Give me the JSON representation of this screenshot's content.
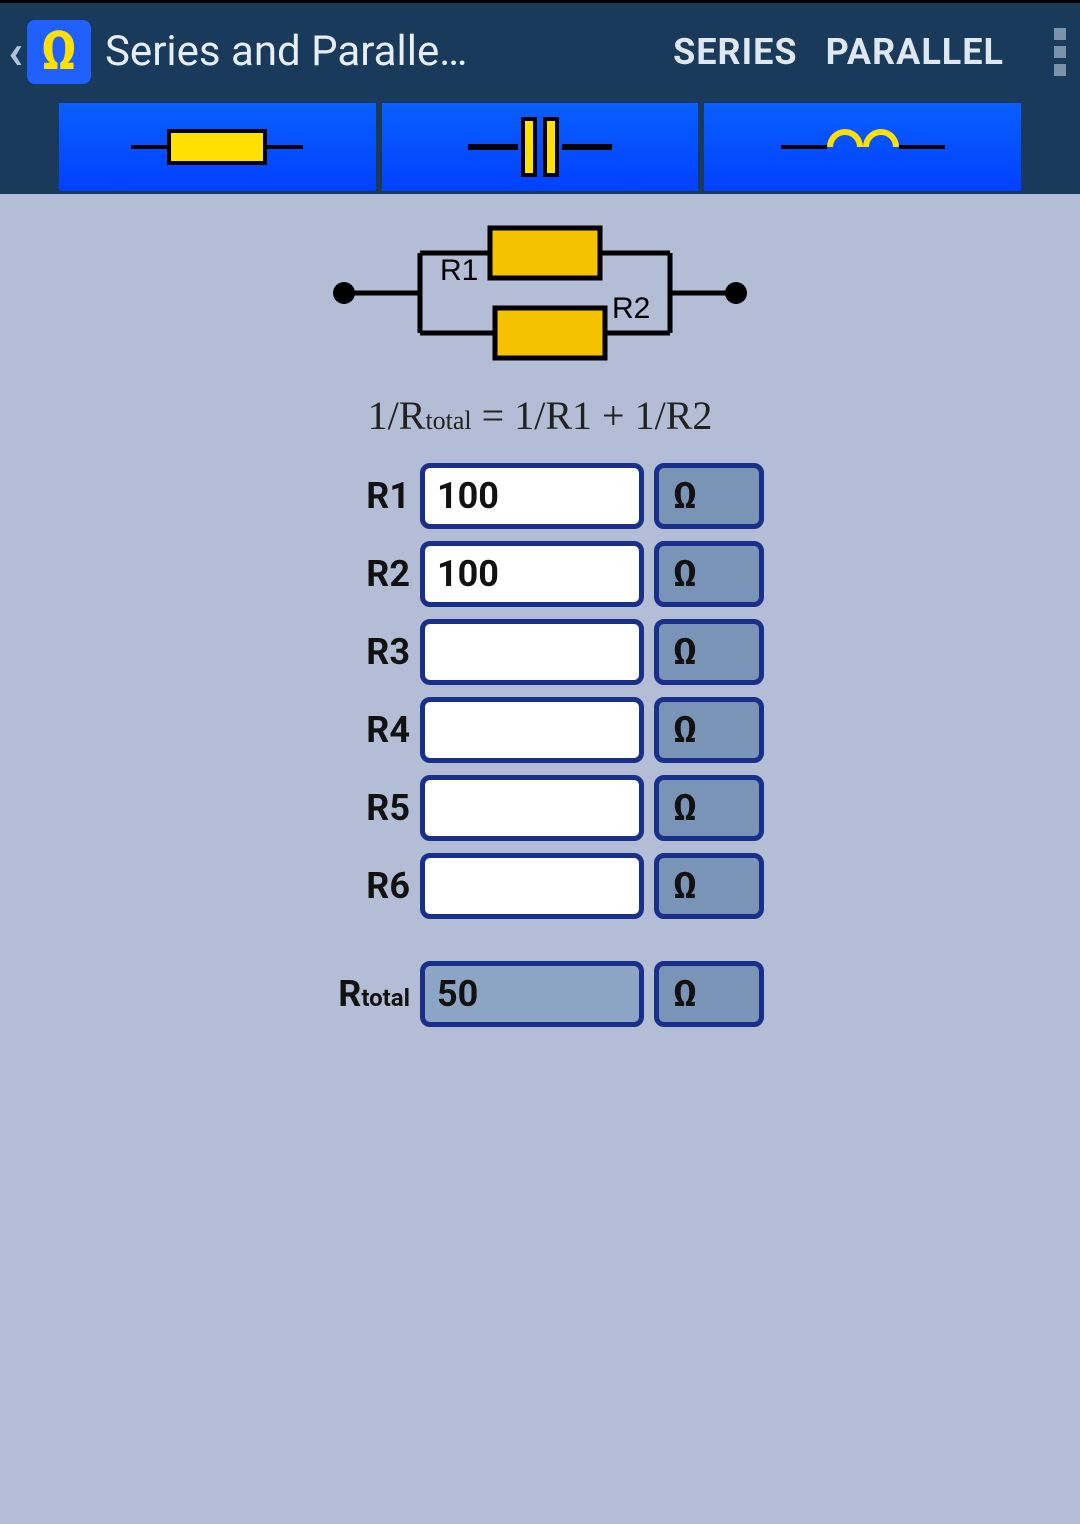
{
  "header": {
    "title": "Series and Parallel co…",
    "tab_series": "SERIES",
    "tab_parallel": "PARALLEL",
    "omega_icon_glyph": "Ω"
  },
  "diagram": {
    "r1_label": "R1",
    "r2_label": "R2"
  },
  "formula": {
    "text_prefix": "1/R",
    "total_sub": "total",
    "text_mid": " = 1/R1 + 1/R2"
  },
  "inputs": [
    {
      "label": "R1",
      "value": "100",
      "unit": "Ω"
    },
    {
      "label": "R2",
      "value": "100",
      "unit": "Ω"
    },
    {
      "label": "R3",
      "value": "",
      "unit": "Ω"
    },
    {
      "label": "R4",
      "value": "",
      "unit": "Ω"
    },
    {
      "label": "R5",
      "value": "",
      "unit": "Ω"
    },
    {
      "label": "R6",
      "value": "",
      "unit": "Ω"
    }
  ],
  "result": {
    "label_prefix": "R",
    "label_sub": "total",
    "value": "50",
    "unit": "Ω"
  }
}
